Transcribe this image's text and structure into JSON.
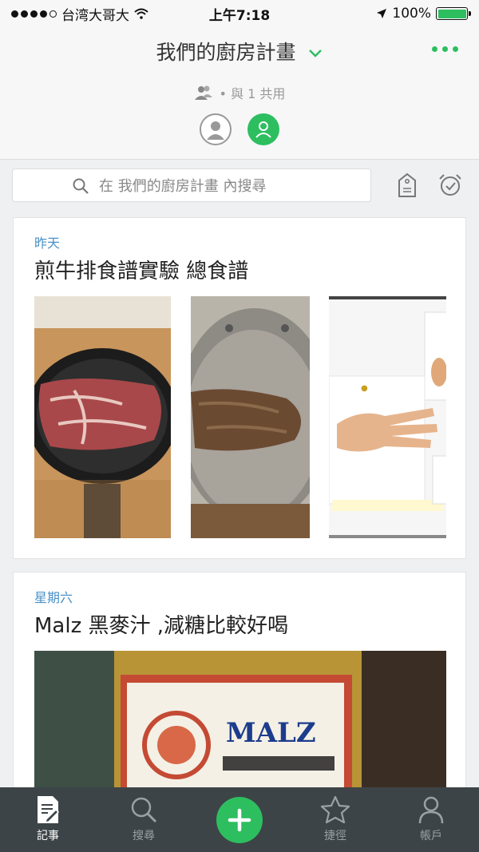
{
  "status_bar": {
    "carrier": "台湾大哥大",
    "time": "上午7:18",
    "battery": "100%",
    "battery_level": 1.0
  },
  "header": {
    "notebook_title": "我們的廚房計畫",
    "share_text": "• 與 1 共用"
  },
  "search": {
    "placeholder": "在 我們的廚房計畫 內搜尋"
  },
  "notes": [
    {
      "date": "昨天",
      "title": "煎牛排食譜實驗 總食譜"
    },
    {
      "date": "星期六",
      "title": "Malz 黑麥汁 ,減糖比較好喝"
    }
  ],
  "tabbar": {
    "items": [
      {
        "label": "記事",
        "icon": "note-icon"
      },
      {
        "label": "搜尋",
        "icon": "search-icon"
      },
      {
        "label": "捷徑",
        "icon": "star-icon"
      },
      {
        "label": "帳戶",
        "icon": "account-icon"
      }
    ]
  },
  "colors": {
    "accent": "#2dbe60",
    "date_blue": "#4a90c6",
    "tabbar_bg": "#3d4447"
  }
}
